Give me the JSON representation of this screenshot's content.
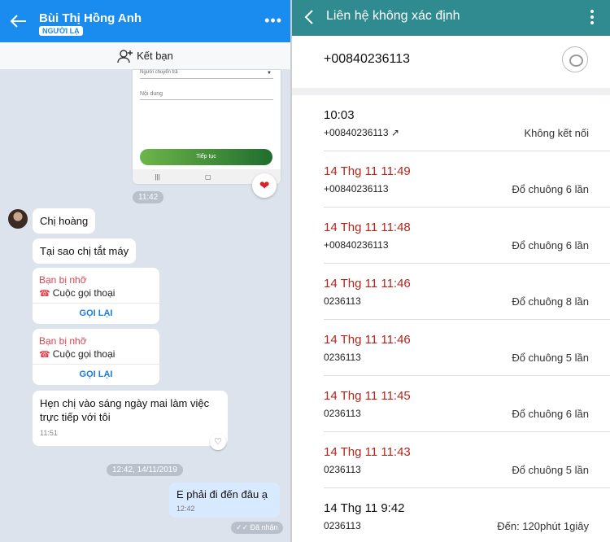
{
  "left": {
    "header": {
      "contact_name": "Bùi Thị Hồng Anh",
      "stranger_badge": "NGƯỜI LẠ",
      "more_label": "•••"
    },
    "add_friend": "Kết bạn",
    "form_image": {
      "select_label": "Người chuyển trả",
      "content_label": "Nội dung",
      "continue_label": "Tiếp tục"
    },
    "messages": [
      {
        "time_pill": "11:42"
      },
      {
        "text": "Chị hoàng"
      },
      {
        "text": "Tại sao chị tắt máy"
      },
      {
        "missed_title": "Bạn bị nhỡ",
        "missed_sub": "Cuộc gọi thoại",
        "call_back": "GỌI LẠI"
      },
      {
        "missed_title": "Bạn bị nhỡ",
        "missed_sub": "Cuộc gọi thoại",
        "call_back": "GỌI LẠI"
      },
      {
        "text_line1": "Hẹn chị vào sáng ngày mai làm việc",
        "text_line2": "trực tiếp với tôi",
        "time": "11:51"
      },
      {
        "time_pill": "12:42, 14/11/2019"
      },
      {
        "outgoing": "E phải đi đến đâu ạ",
        "time": "12:42"
      }
    ],
    "received_label": "Đã nhận"
  },
  "right": {
    "title": "Liên hệ không xác định",
    "number": "+00840236113",
    "calls": [
      {
        "time": "10:03",
        "number": "+00840236113 ↗",
        "status": "Không kết nối",
        "missed": false
      },
      {
        "time": "14 Thg 11 11:49",
        "number": "+00840236113",
        "status": "Đổ chuông 6 lần",
        "missed": true
      },
      {
        "time": "14 Thg 11 11:48",
        "number": "+00840236113",
        "status": "Đổ chuông 6 lần",
        "missed": true
      },
      {
        "time": "14 Thg 11 11:46",
        "number": "0236113",
        "status": "Đổ chuông 8 lần",
        "missed": true
      },
      {
        "time": "14 Thg 11 11:46",
        "number": "0236113",
        "status": "Đổ chuông 5 lần",
        "missed": true
      },
      {
        "time": "14 Thg 11 11:45",
        "number": "0236113",
        "status": "Đổ chuông 6 lần",
        "missed": true
      },
      {
        "time": "14 Thg 11 11:43",
        "number": "0236113",
        "status": "Đổ chuông 5 lần",
        "missed": true
      },
      {
        "time": "14 Thg 11 9:42",
        "number": "0236113",
        "status": "Đến: 120phút 1giây",
        "missed": false
      }
    ]
  },
  "colors": {
    "zalo_blue": "#1a8cf0",
    "teal_header": "#2f8b8f",
    "missed_red": "#b3251c"
  }
}
